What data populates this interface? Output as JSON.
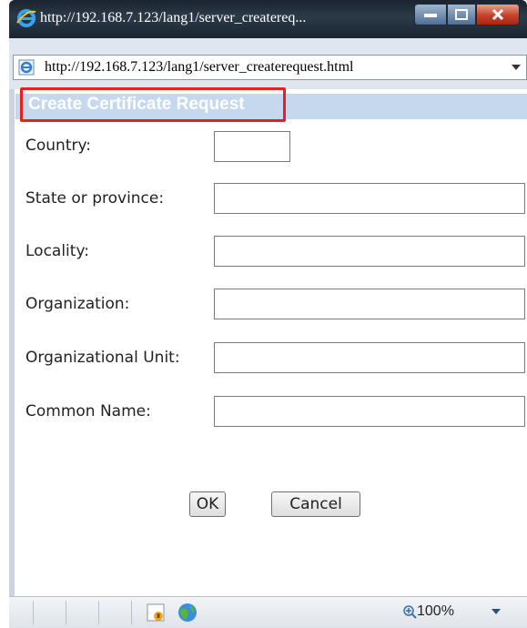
{
  "window": {
    "title": "http://192.168.7.123/lang1/server_createreq...",
    "address": "http://192.168.7.123/lang1/server_createrequest.html"
  },
  "page": {
    "header": "Create Certificate Request"
  },
  "form": {
    "country_label": "Country:",
    "state_label": "State or province:",
    "locality_label": "Locality:",
    "organization_label": "Organization:",
    "org_unit_label": "Organizational Unit:",
    "common_name_label": "Common Name:"
  },
  "buttons": {
    "ok": "OK",
    "cancel": "Cancel"
  },
  "statusbar": {
    "zoom": "100%"
  },
  "icons": {
    "browser": "ie-logo-icon",
    "page": "ie-page-icon",
    "security": "security-lock-icon",
    "internet": "globe-icon",
    "zoom": "zoom-icon"
  }
}
